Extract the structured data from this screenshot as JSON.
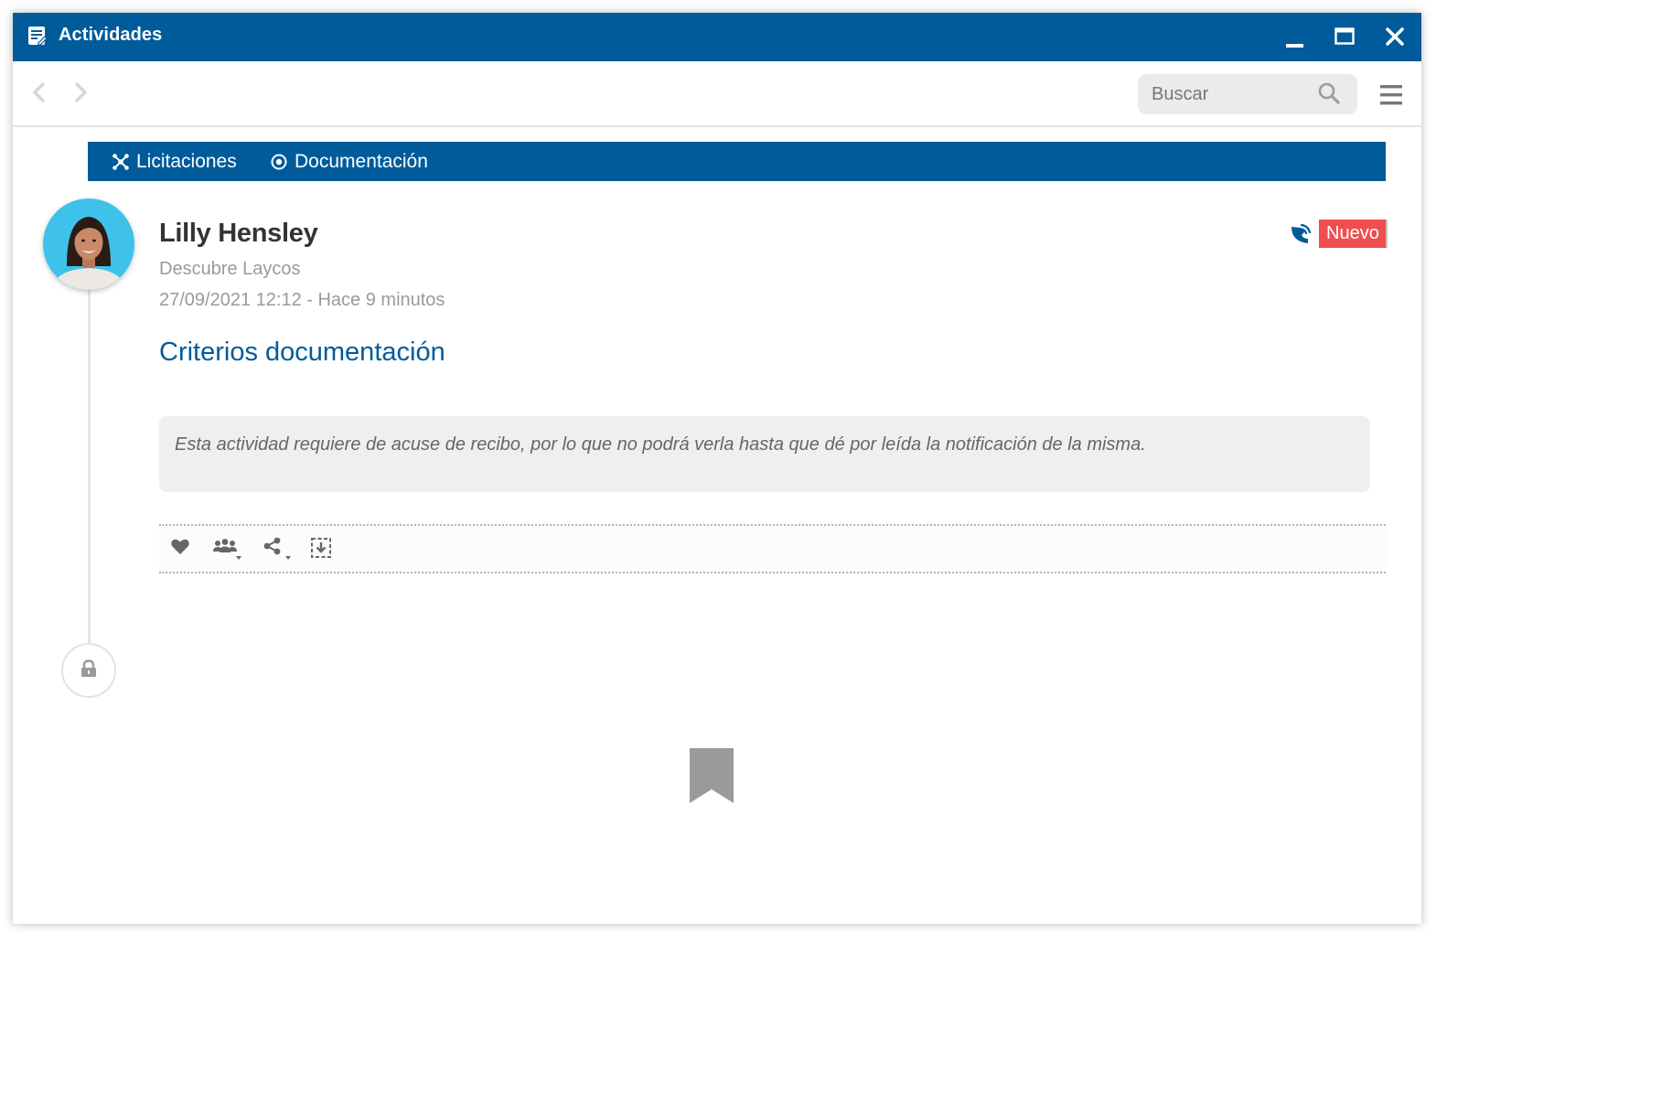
{
  "window": {
    "title": "Actividades",
    "controls": {
      "minimize": "minimize-icon",
      "maximize": "maximize-icon",
      "close": "close-icon"
    }
  },
  "toolbar": {
    "search": {
      "placeholder": "Buscar"
    }
  },
  "categories": [
    {
      "label": "Licitaciones",
      "icon": "network-icon"
    },
    {
      "label": "Documentación",
      "icon": "radio-target-icon"
    }
  ],
  "activity": {
    "author": "Lilly Hensley",
    "company": "Descubre Laycos",
    "timestamp": "27/09/2021 12:12 - Hace 9 minutos",
    "title": "Criterios documentación",
    "badge": "Nuevo",
    "notice": "Esta actividad requiere de acuse de recibo, por lo que no podrá verla hasta que dé por leída la notificación de la misma.",
    "actions": [
      "heart-icon",
      "group-icon",
      "share-icon",
      "download-icon"
    ]
  },
  "colors": {
    "brand": "#005b9a",
    "badge": "#f04e4e",
    "avatar_bg": "#3ec1ea"
  }
}
